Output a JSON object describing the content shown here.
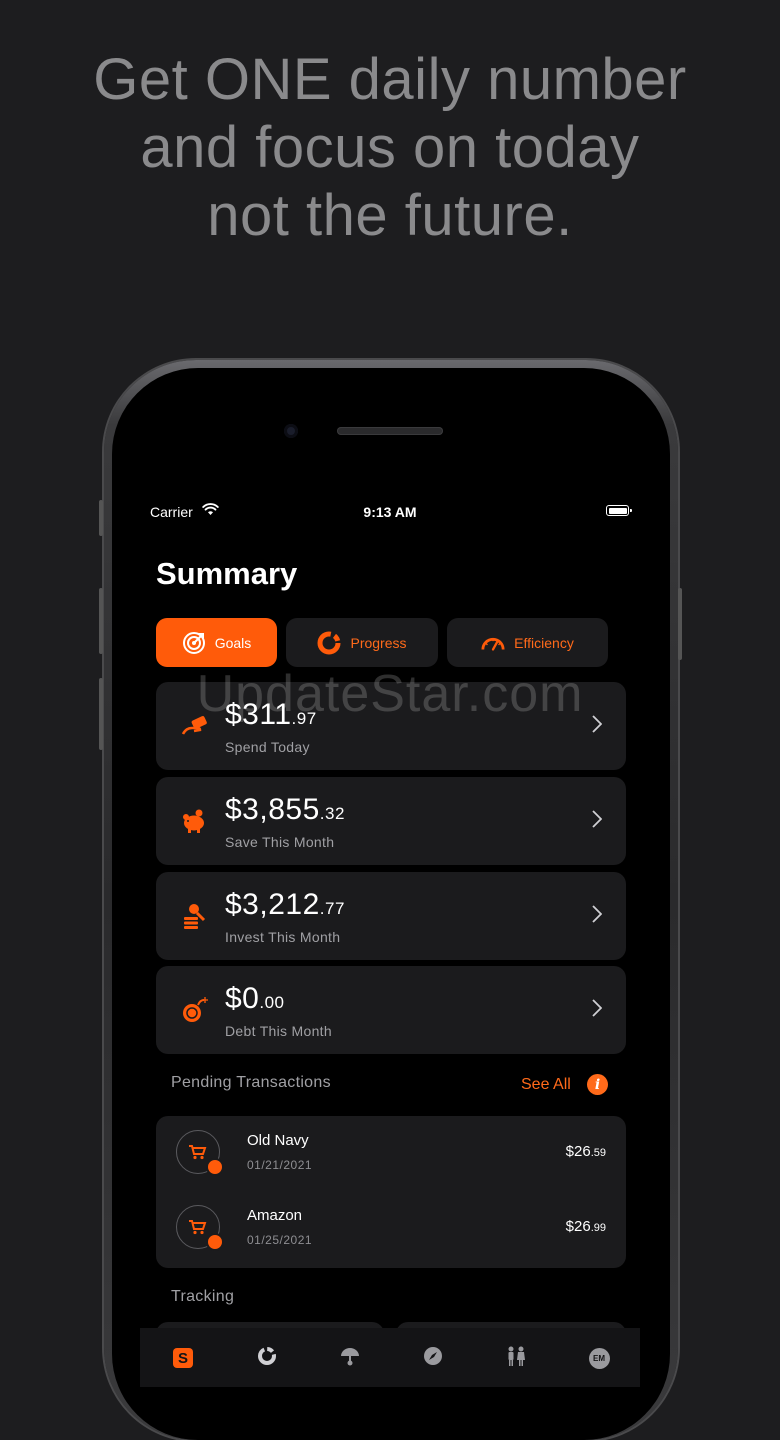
{
  "headline": {
    "line1": "Get ONE daily number",
    "line2": "and focus on today",
    "line3": "not the future."
  },
  "status_bar": {
    "carrier": "Carrier",
    "time": "9:13 AM"
  },
  "page_title": "Summary",
  "tabs": [
    {
      "label": "Goals",
      "icon": "target-icon",
      "active": true
    },
    {
      "label": "Progress",
      "icon": "progress-ring-icon",
      "active": false
    },
    {
      "label": "Efficiency",
      "icon": "gauge-icon",
      "active": false
    }
  ],
  "summary_cards": [
    {
      "dollars": "$311",
      "cents": ".97",
      "label": "Spend Today",
      "icon": "money-hand-icon"
    },
    {
      "dollars": "$3,855",
      "cents": ".32",
      "label": "Save This Month",
      "icon": "piggy-bank-icon"
    },
    {
      "dollars": "$3,212",
      "cents": ".77",
      "label": "Invest This Month",
      "icon": "invest-coins-icon"
    },
    {
      "dollars": "$0",
      "cents": ".00",
      "label": "Debt This Month",
      "icon": "debt-bomb-icon"
    }
  ],
  "pending": {
    "title": "Pending Transactions",
    "see_all": "See All",
    "info": "i",
    "items": [
      {
        "name": "Old Navy",
        "date": "01/21/2021",
        "dollars": "$26",
        "cents": ".59"
      },
      {
        "name": "Amazon",
        "date": "01/25/2021",
        "dollars": "$26",
        "cents": ".99"
      }
    ]
  },
  "tracking": {
    "title": "Tracking"
  },
  "tab_bar": [
    {
      "icon": "summary-s-icon",
      "label": "S"
    },
    {
      "icon": "progress-ring-icon"
    },
    {
      "icon": "umbrella-icon"
    },
    {
      "icon": "compass-icon"
    },
    {
      "icon": "people-icon"
    },
    {
      "icon": "em-badge-icon",
      "label": "EM"
    }
  ],
  "watermark": "UpdateStar.com",
  "colors": {
    "accent": "#ff5b0a",
    "card": "#1b1b1d",
    "background": "#1d1d1f"
  }
}
